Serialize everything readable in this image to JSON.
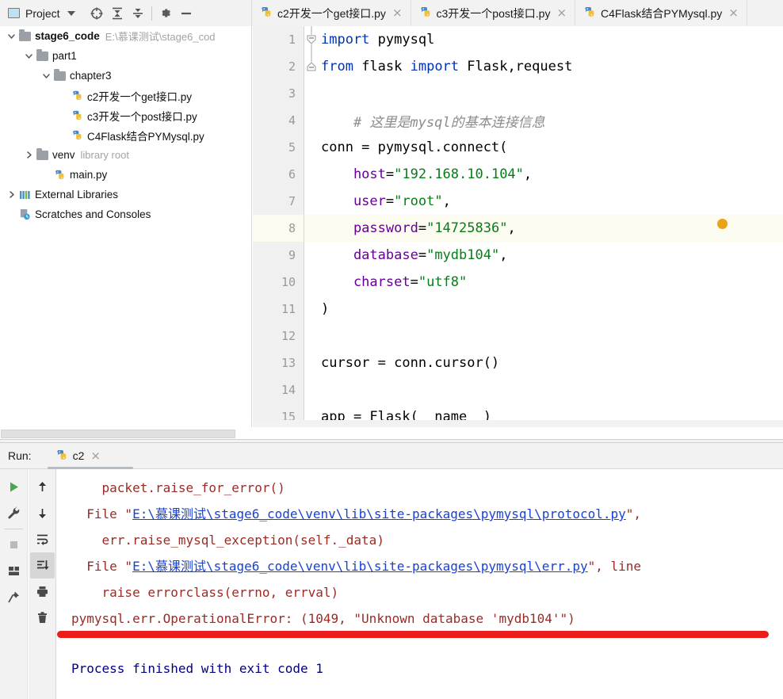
{
  "project_toolbar": {
    "title": "Project",
    "dropdown_icon": "chevron-down-icon",
    "icons": [
      "locate-target-icon",
      "expand-all-icon",
      "collapse-all-icon",
      "gear-icon",
      "minimize-icon"
    ]
  },
  "editor_tabs": [
    {
      "label": "c2开发一个get接口.py",
      "icon": "python-file-icon",
      "close": "×",
      "active": false
    },
    {
      "label": "c3开发一个post接口.py",
      "icon": "python-file-icon",
      "close": "×",
      "active": false
    },
    {
      "label": "C4Flask结合PYMysql.py",
      "icon": "python-file-icon",
      "close": "×",
      "active": true
    }
  ],
  "tree": {
    "items": [
      {
        "depth": 0,
        "arrow": "expanded",
        "icon": "folder-icon",
        "label": "stage6_code",
        "bold": true,
        "sub": "E:\\慕课测试\\stage6_cod"
      },
      {
        "depth": 1,
        "arrow": "expanded",
        "icon": "folder-icon",
        "label": "part1",
        "bold": false,
        "sub": ""
      },
      {
        "depth": 2,
        "arrow": "expanded",
        "icon": "folder-icon",
        "label": "chapter3",
        "bold": false,
        "sub": ""
      },
      {
        "depth": 3,
        "arrow": "none",
        "icon": "python-file-icon",
        "label": "c2开发一个get接口.py",
        "bold": false,
        "sub": ""
      },
      {
        "depth": 3,
        "arrow": "none",
        "icon": "python-file-icon",
        "label": "c3开发一个post接口.py",
        "bold": false,
        "sub": ""
      },
      {
        "depth": 3,
        "arrow": "none",
        "icon": "python-file-icon",
        "label": "C4Flask结合PYMysql.py",
        "bold": false,
        "sub": ""
      },
      {
        "depth": 1,
        "arrow": "collapsed",
        "icon": "folder-icon",
        "label": "venv",
        "bold": false,
        "sub": "library root"
      },
      {
        "depth": 2,
        "arrow": "none",
        "icon": "python-file-icon",
        "label": "main.py",
        "bold": false,
        "sub": ""
      },
      {
        "depth": 0,
        "arrow": "collapsed",
        "icon": "external-libraries-icon",
        "label": "External Libraries",
        "bold": false,
        "sub": ""
      },
      {
        "depth": 0,
        "arrow": "none",
        "icon": "scratches-icon",
        "label": "Scratches and Consoles",
        "bold": false,
        "sub": ""
      }
    ]
  },
  "editor": {
    "current_line": 8,
    "caret_marker": "orange-dot-caret",
    "lines": [
      {
        "n": "1",
        "fold": "start",
        "segments": [
          {
            "t": "import",
            "c": "kw"
          },
          {
            "t": " pymysql",
            "c": ""
          }
        ]
      },
      {
        "n": "2",
        "fold": "end",
        "segments": [
          {
            "t": "from",
            "c": "kw"
          },
          {
            "t": " flask ",
            "c": ""
          },
          {
            "t": "import",
            "c": "kw"
          },
          {
            "t": " Flask,request",
            "c": ""
          }
        ]
      },
      {
        "n": "3",
        "fold": "none",
        "segments": []
      },
      {
        "n": "4",
        "fold": "none",
        "segments": [
          {
            "t": "    # 这里是mysql的基本连接信息",
            "c": "cmt"
          }
        ]
      },
      {
        "n": "5",
        "fold": "none",
        "segments": [
          {
            "t": "conn = pymysql.connect(",
            "c": ""
          }
        ]
      },
      {
        "n": "6",
        "fold": "none",
        "segments": [
          {
            "t": "    host",
            "c": "par"
          },
          {
            "t": "=",
            "c": ""
          },
          {
            "t": "\"192.168.10.104\"",
            "c": "str"
          },
          {
            "t": ",",
            "c": ""
          }
        ]
      },
      {
        "n": "7",
        "fold": "none",
        "segments": [
          {
            "t": "    user",
            "c": "par"
          },
          {
            "t": "=",
            "c": ""
          },
          {
            "t": "\"root\"",
            "c": "str"
          },
          {
            "t": ",",
            "c": ""
          }
        ]
      },
      {
        "n": "8",
        "fold": "none",
        "segments": [
          {
            "t": "    password",
            "c": "par"
          },
          {
            "t": "=",
            "c": ""
          },
          {
            "t": "\"14725836\"",
            "c": "str"
          },
          {
            "t": ",",
            "c": ""
          }
        ]
      },
      {
        "n": "9",
        "fold": "none",
        "segments": [
          {
            "t": "    database",
            "c": "par"
          },
          {
            "t": "=",
            "c": ""
          },
          {
            "t": "\"mydb104\"",
            "c": "str"
          },
          {
            "t": ",",
            "c": ""
          }
        ]
      },
      {
        "n": "10",
        "fold": "none",
        "segments": [
          {
            "t": "    charset",
            "c": "par"
          },
          {
            "t": "=",
            "c": ""
          },
          {
            "t": "\"utf8\"",
            "c": "str"
          }
        ]
      },
      {
        "n": "11",
        "fold": "none",
        "segments": [
          {
            "t": ")",
            "c": ""
          }
        ]
      },
      {
        "n": "12",
        "fold": "none",
        "segments": []
      },
      {
        "n": "13",
        "fold": "none",
        "segments": [
          {
            "t": "cursor = conn.cursor()",
            "c": ""
          }
        ]
      },
      {
        "n": "14",
        "fold": "none",
        "segments": []
      },
      {
        "n": "15",
        "fold": "none",
        "segments": [
          {
            "t": "app = Flask(__name__)",
            "c": ""
          }
        ]
      }
    ]
  },
  "run_panel": {
    "label": "Run:",
    "tab": {
      "label": "c2",
      "icon": "python-file-icon",
      "close": "×"
    },
    "tools_left": [
      "run-icon",
      "wrench-icon",
      "stop-icon",
      "layout-icon",
      "pin-icon"
    ],
    "tools_right": [
      "up-arrow-icon",
      "down-arrow-icon",
      "soft-wrap-icon",
      "scroll-to-end-icon",
      "print-icon",
      "trash-icon"
    ],
    "active_tool": "scroll-to-end-icon",
    "console_lines": [
      {
        "parts": [
          {
            "t": "    packet.raise_for_error()",
            "c": "err"
          }
        ]
      },
      {
        "parts": [
          {
            "t": "  File \"",
            "c": "err"
          },
          {
            "t": "E:\\慕课测试\\stage6_code\\venv\\lib\\site-packages\\pymysql\\protocol.py",
            "c": "lnk"
          },
          {
            "t": "\",",
            "c": "err"
          }
        ]
      },
      {
        "parts": [
          {
            "t": "    err.raise_mysql_exception(self._data)",
            "c": "err"
          }
        ]
      },
      {
        "parts": [
          {
            "t": "  File \"",
            "c": "err"
          },
          {
            "t": "E:\\慕课测试\\stage6_code\\venv\\lib\\site-packages\\pymysql\\err.py",
            "c": "lnk"
          },
          {
            "t": "\", line",
            "c": "err"
          }
        ]
      },
      {
        "parts": [
          {
            "t": "    raise errorclass(errno, errval)",
            "c": "err"
          }
        ]
      },
      {
        "parts": [
          {
            "t": "pymysql.err.OperationalError: (1049, \"Unknown database 'mydb104'\")",
            "c": "err"
          }
        ]
      }
    ],
    "separator_color": "#ec1c1c",
    "final_line": "Process finished with exit code 1"
  },
  "colors": {
    "keyword": "#0033b3",
    "string": "#067d17",
    "comment": "#8c8c8c",
    "parameter": "#660099",
    "error": "#9b2b24",
    "link": "#1a42d0",
    "exit_message": "#000080",
    "current_line_bg": "#fcfbf0",
    "caret": "#e8a317"
  }
}
